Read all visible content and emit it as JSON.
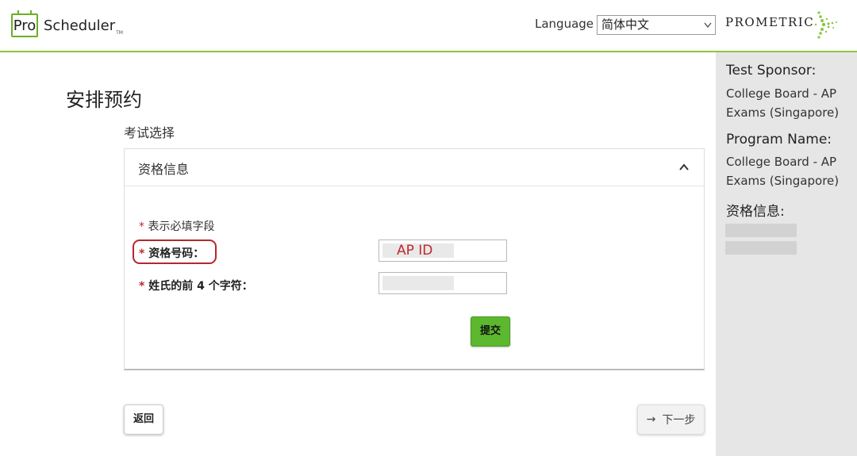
{
  "header": {
    "logo_pro": "Pro",
    "logo_scheduler": "Scheduler",
    "logo_tm": "TM",
    "language_label": "Language",
    "language_selected": "简体中文",
    "brand": "PROMETRIC",
    "accent_color": "#8cc63f"
  },
  "main": {
    "page_title": "安排预约",
    "section_title": "考试选择",
    "card_title": "资格信息",
    "required_note_star": "*",
    "required_note": "表示必填字段",
    "fields": [
      {
        "star": "*",
        "label": "资格号码：",
        "value": "AP ID"
      },
      {
        "star": "*",
        "label": "姓氏的前 4 个字符：",
        "value": ""
      }
    ],
    "submit_label": "提交",
    "back_label": "返回",
    "next_label": "下一步"
  },
  "sidebar": {
    "sponsor_heading": "Test Sponsor:",
    "sponsor_value": "College Board - AP Exams (Singapore)",
    "program_heading": "Program Name:",
    "program_value": "College Board - AP Exams (Singapore)",
    "eligibility_heading": "资格信息:"
  }
}
